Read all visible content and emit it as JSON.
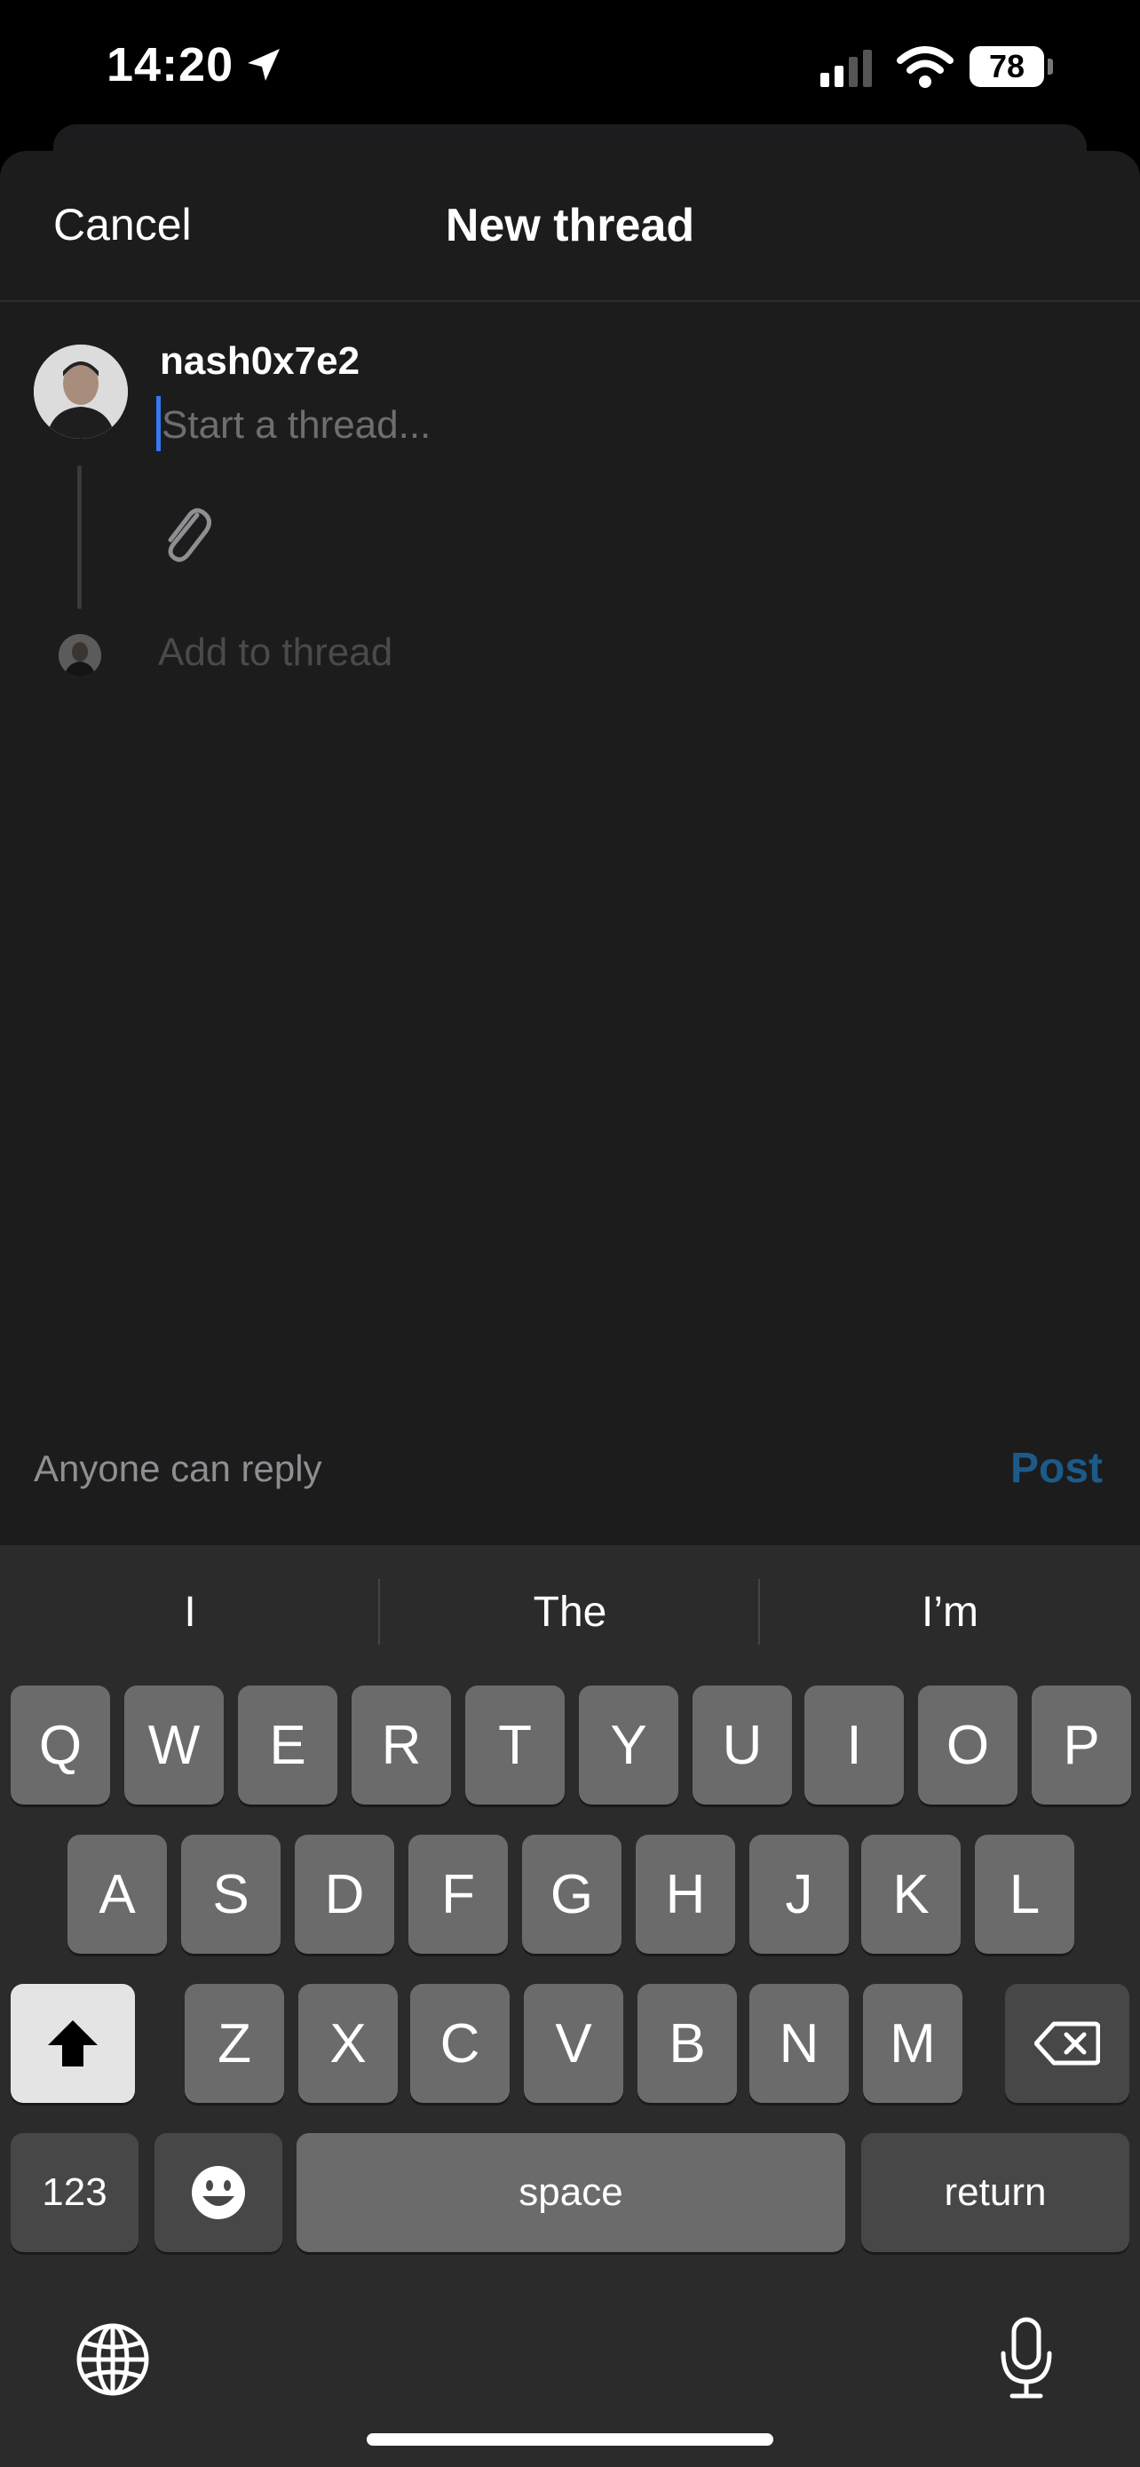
{
  "status_bar": {
    "time": "14:20",
    "battery": "78",
    "icons": [
      "location-arrow-icon",
      "cellular-signal-icon",
      "wifi-icon",
      "battery-icon"
    ]
  },
  "nav": {
    "cancel_label": "Cancel",
    "title": "New thread"
  },
  "compose": {
    "username": "nash0x7e2",
    "placeholder": "Start a thread...",
    "attachment_icon": "paperclip-icon",
    "add_to_thread": "Add to thread"
  },
  "footer": {
    "reply_setting": "Anyone can reply",
    "post_label": "Post",
    "post_color": "#1c5a8a"
  },
  "keyboard": {
    "suggestions": [
      "I",
      "The",
      "I’m"
    ],
    "row1": [
      "Q",
      "W",
      "E",
      "R",
      "T",
      "Y",
      "U",
      "I",
      "O",
      "P"
    ],
    "row2": [
      "A",
      "S",
      "D",
      "F",
      "G",
      "H",
      "J",
      "K",
      "L"
    ],
    "row3": [
      "Z",
      "X",
      "C",
      "V",
      "B",
      "N",
      "M"
    ],
    "numbers_label": "123",
    "space_label": "space",
    "return_label": "return",
    "icons": [
      "shift-icon",
      "backspace-icon",
      "emoji-icon",
      "globe-icon",
      "microphone-icon"
    ]
  },
  "colors": {
    "accent_caret": "#3478f6",
    "sheet_background": "#1c1c1c",
    "keyboard_background": "#2b2b2b"
  }
}
